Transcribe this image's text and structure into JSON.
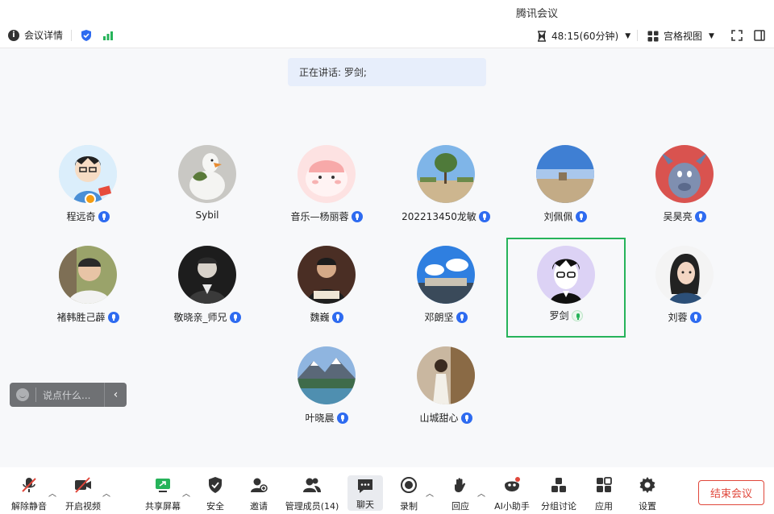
{
  "app": {
    "title": "腾讯会议"
  },
  "topbar": {
    "meeting_info": "会议详情",
    "timer": "48:15(60分钟)",
    "view": "宫格视图"
  },
  "speaking": {
    "text": "正在讲话: 罗剑;"
  },
  "participants": [
    {
      "name": "程远奇"
    },
    {
      "name": "Sybil"
    },
    {
      "name": "音乐—杨丽蓉"
    },
    {
      "name": "202213450龙敏"
    },
    {
      "name": "刘佩佩"
    },
    {
      "name": "吴昊亮"
    },
    {
      "name": "褚韩胜己薜"
    },
    {
      "name": "敬晓亲_师兄"
    },
    {
      "name": "魏巍"
    },
    {
      "name": "邓朗坚"
    },
    {
      "name": "罗剑"
    },
    {
      "name": "刘蓉"
    },
    {
      "name": "叶晓晨"
    },
    {
      "name": "山城甜心"
    }
  ],
  "chat": {
    "placeholder": "说点什么..."
  },
  "toolbar": {
    "unmute": "解除静音",
    "start_video": "开启视频",
    "share_screen": "共享屏幕",
    "security": "安全",
    "invite": "邀请",
    "manage_members": "管理成员(14)",
    "chat": "聊天",
    "record": "录制",
    "react": "回应",
    "ai_assistant": "AI小助手",
    "breakout": "分组讨论",
    "apps": "应用",
    "settings": "设置",
    "end_meeting": "结束会议"
  },
  "colors": {
    "accent_blue": "#2e6bf0",
    "active_border": "#26b35a",
    "end_red": "#e0473b"
  }
}
